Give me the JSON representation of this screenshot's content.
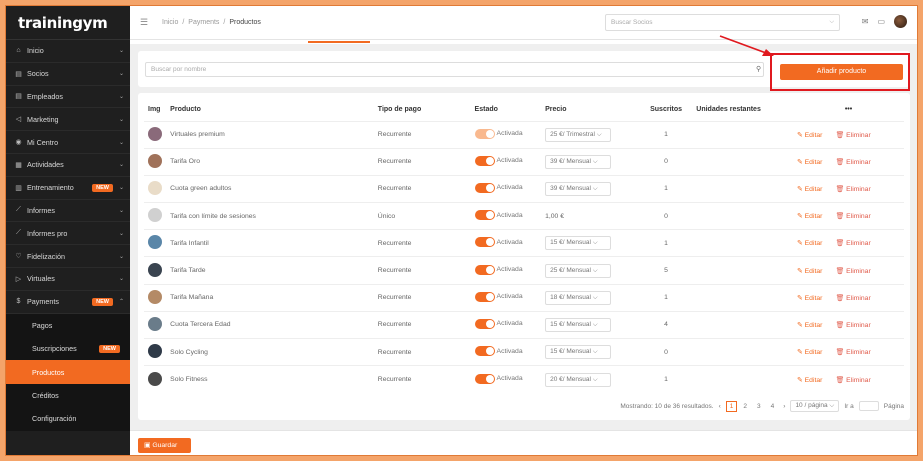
{
  "brand": "trainingym",
  "sidebar": {
    "items": [
      {
        "icon": "home-icon",
        "glyph": "⌂",
        "label": "Inicio",
        "badge": ""
      },
      {
        "icon": "id-card-icon",
        "glyph": "▤",
        "label": "Socios",
        "badge": ""
      },
      {
        "icon": "id-card-icon",
        "glyph": "▤",
        "label": "Empleados",
        "badge": ""
      },
      {
        "icon": "megaphone-icon",
        "glyph": "◁",
        "label": "Marketing",
        "badge": ""
      },
      {
        "icon": "location-icon",
        "glyph": "◉",
        "label": "Mi Centro",
        "badge": ""
      },
      {
        "icon": "calendar-icon",
        "glyph": "▦",
        "label": "Actividades",
        "badge": ""
      },
      {
        "icon": "clipboard-icon",
        "glyph": "▥",
        "label": "Entrenamiento",
        "badge": "NEW"
      },
      {
        "icon": "chart-line-icon",
        "glyph": "⟋",
        "label": "Informes",
        "badge": ""
      },
      {
        "icon": "chart-line-icon",
        "glyph": "⟋",
        "label": "Informes pro",
        "badge": ""
      },
      {
        "icon": "heart-icon",
        "glyph": "♡",
        "label": "Fidelización",
        "badge": ""
      },
      {
        "icon": "video-icon",
        "glyph": "▷",
        "label": "Virtuales",
        "badge": ""
      },
      {
        "icon": "dollar-icon",
        "glyph": "$",
        "label": "Payments",
        "badge": "NEW"
      }
    ],
    "sub": [
      {
        "label": "Pagos",
        "badge": ""
      },
      {
        "label": "Suscripciones",
        "badge": "NEW"
      },
      {
        "label": "Productos",
        "badge": ""
      },
      {
        "label": "Créditos",
        "badge": ""
      },
      {
        "label": "Configuración",
        "badge": ""
      }
    ]
  },
  "breadcrumb": {
    "home": "Inicio",
    "section": "Payments",
    "current": "Productos",
    "sep": "/"
  },
  "topsearch": {
    "placeholder": "Buscar Socios"
  },
  "search": {
    "placeholder": "Buscar por nombre"
  },
  "add_button": "Añadir producto",
  "table": {
    "headers": [
      "Img",
      "Producto",
      "Tipo de pago",
      "Estado",
      "Precio",
      "Suscritos",
      "Unidades restantes",
      "•••"
    ],
    "rows": [
      {
        "product": "Virtuales premium",
        "type": "Recurrente",
        "status": "Activada",
        "price": "25 €/ Trimestral",
        "price_select": true,
        "subs": "1",
        "thumb": "#8a6a7a",
        "light": true
      },
      {
        "product": "Tarifa Oro",
        "type": "Recurrente",
        "status": "Activada",
        "price": "39 €/ Mensual",
        "price_select": true,
        "subs": "0",
        "thumb": "#a0725a",
        "light": false
      },
      {
        "product": "Cuota green adultos",
        "type": "Recurrente",
        "status": "Activada",
        "price": "39 €/ Mensual",
        "price_select": true,
        "subs": "1",
        "thumb": "#e9dcc8",
        "light": false
      },
      {
        "product": "Tarifa con límite de sesiones",
        "type": "Único",
        "status": "Activada",
        "price": "1,00 €",
        "price_select": false,
        "subs": "0",
        "thumb": "#d0d0d0",
        "light": false
      },
      {
        "product": "Tarifa Infantil",
        "type": "Recurrente",
        "status": "Activada",
        "price": "15 €/ Mensual",
        "price_select": true,
        "subs": "1",
        "thumb": "#5a86a8",
        "light": false
      },
      {
        "product": "Tarifa Tarde",
        "type": "Recurrente",
        "status": "Activada",
        "price": "25 €/ Mensual",
        "price_select": true,
        "subs": "5",
        "thumb": "#3a4450",
        "light": false
      },
      {
        "product": "Tarifa Mañana",
        "type": "Recurrente",
        "status": "Activada",
        "price": "18 €/ Mensual",
        "price_select": true,
        "subs": "1",
        "thumb": "#b48a66",
        "light": false
      },
      {
        "product": "Cuota Tercera Edad",
        "type": "Recurrente",
        "status": "Activada",
        "price": "15 €/ Mensual",
        "price_select": true,
        "subs": "4",
        "thumb": "#6a7c8a",
        "light": false
      },
      {
        "product": "Solo Cycling",
        "type": "Recurrente",
        "status": "Activada",
        "price": "15 €/ Mensual",
        "price_select": true,
        "subs": "0",
        "thumb": "#2f3a48",
        "light": false
      },
      {
        "product": "Solo Fitness",
        "type": "Recurrente",
        "status": "Activada",
        "price": "20 €/ Mensual",
        "price_select": true,
        "subs": "1",
        "thumb": "#4a4a4a",
        "light": false
      }
    ],
    "edit_label": "Editar",
    "delete_label": "Eliminar"
  },
  "pagination": {
    "summary": "Mostrando: 10 de 36 resultados.",
    "pages": [
      "1",
      "2",
      "3",
      "4"
    ],
    "per_page": "10 / página",
    "goto": "Ir a",
    "page_label": "Página"
  },
  "save_button": "Guardar",
  "colors": {
    "accent": "#f26a21",
    "sidebar": "#1f1f1f",
    "highlight": "#e0191f"
  }
}
